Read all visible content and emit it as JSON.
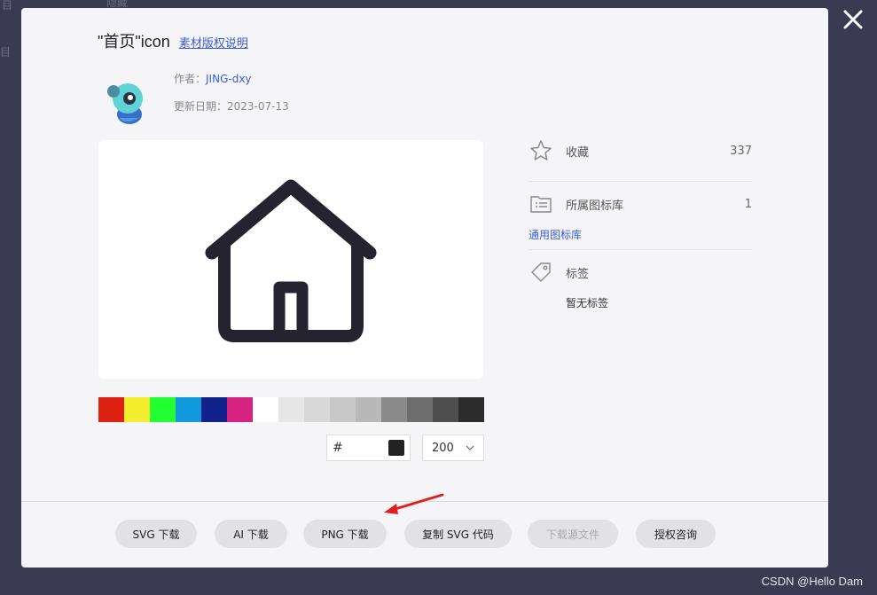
{
  "backdrop": {
    "fragment1": "目",
    "fragment2": "目",
    "fragment3": "隐藏"
  },
  "watermark": "CSDN @Hello Dam",
  "dialog": {
    "title": "\"首页\"icon",
    "license_link": "素材版权说明",
    "author_label": "作者：",
    "author_name": "JING-dxy",
    "updated_label": "更新日期：",
    "updated_date": "2023-07-13",
    "icon_name": "house-icon"
  },
  "palette": {
    "colors": [
      "#dd2211",
      "#f5ee2e",
      "#22ff33",
      "#1199dd",
      "#11228d",
      "#d6237f",
      "#ffffff",
      "#e6e6e6",
      "#d8d8d8",
      "#c8c8c8",
      "#b8b8b8",
      "#8a8a8a",
      "#6e6e6e",
      "#4e4e4e",
      "#2c2c2c"
    ],
    "hex_prefix": "#",
    "current_color": "#222222",
    "size_value": "200"
  },
  "side": {
    "favorite_label": "收藏",
    "favorite_count": "337",
    "library_label": "所属图标库",
    "library_count": "1",
    "library_link": "通用图标库",
    "tags_label": "标签",
    "tags_empty": "暂无标签"
  },
  "actions": {
    "svg_download": "SVG 下载",
    "ai_download": "AI 下载",
    "png_download": "PNG 下载",
    "copy_svg": "复制 SVG 代码",
    "source_download": "下载源文件",
    "license_consult": "授权咨询"
  },
  "annotation_color": "#e02020"
}
